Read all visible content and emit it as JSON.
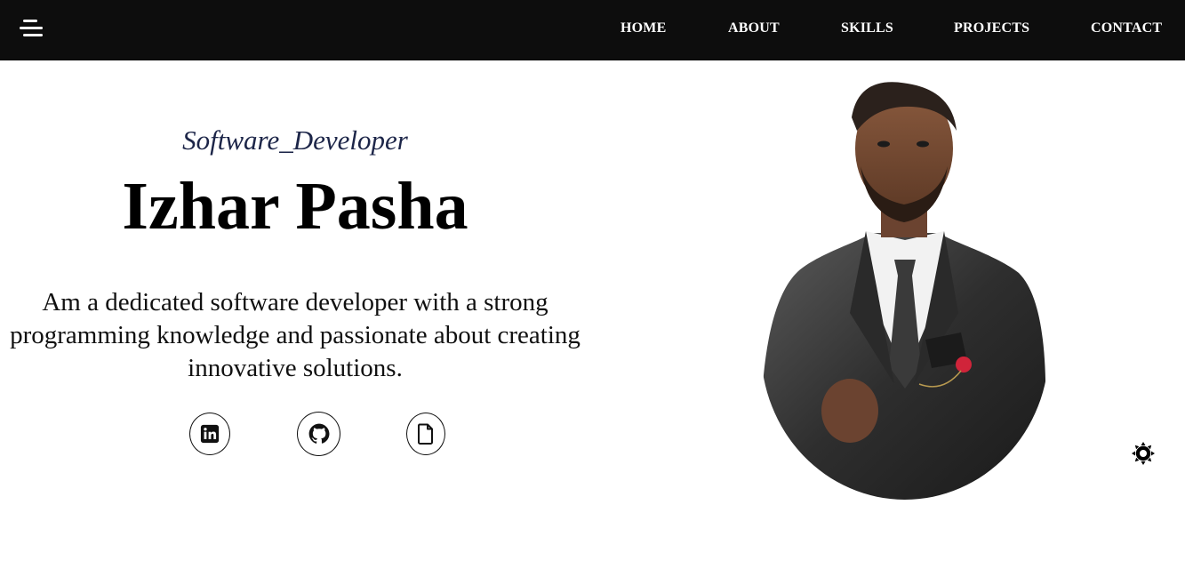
{
  "nav": {
    "menu_icon": "hamburger-menu-icon",
    "links": [
      {
        "label": "HOME"
      },
      {
        "label": "ABOUT"
      },
      {
        "label": "SKILLS"
      },
      {
        "label": "PROJECTS"
      },
      {
        "label": "CONTACT"
      }
    ]
  },
  "hero": {
    "subtitle": "Software_Developer",
    "name": "Izhar Pasha",
    "bio": "Am a dedicated software developer with a strong programming knowledge and passionate about creating innovative solutions."
  },
  "social": [
    {
      "icon": "linkedin-icon"
    },
    {
      "icon": "github-icon"
    },
    {
      "icon": "resume-file-icon"
    }
  ],
  "theme_toggle": {
    "icon": "sun-icon"
  },
  "colors": {
    "navbar_bg": "#0d0d0d",
    "nav_text": "#ffffff",
    "subtitle": "#1c2548",
    "name": "#000000"
  }
}
